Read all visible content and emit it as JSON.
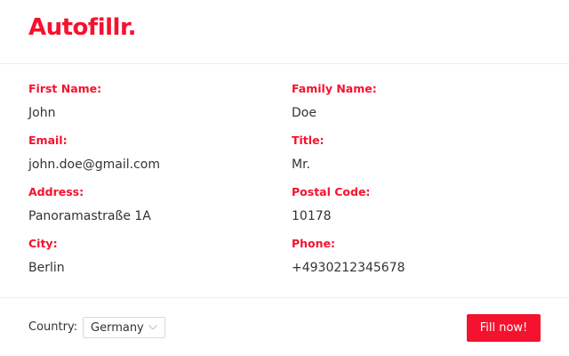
{
  "app": {
    "logo_text": "Autofillr.",
    "accent_color": "#f5122e"
  },
  "fields": {
    "first_name": {
      "label": "First Name:",
      "value": "John"
    },
    "family_name": {
      "label": "Family Name:",
      "value": "Doe"
    },
    "email": {
      "label": "Email:",
      "value": "john.doe@gmail.com"
    },
    "title": {
      "label": "Title:",
      "value": "Mr."
    },
    "address": {
      "label": "Address:",
      "value": "Panoramastraße 1A"
    },
    "postal_code": {
      "label": "Postal Code:",
      "value": "10178"
    },
    "city": {
      "label": "City:",
      "value": "Berlin"
    },
    "phone": {
      "label": "Phone:",
      "value": "+4930212345678"
    }
  },
  "footer": {
    "country_label": "Country:",
    "country_selected": "Germany",
    "country_select_icon": "chevron-down-icon",
    "fill_button_label": "Fill now!"
  }
}
